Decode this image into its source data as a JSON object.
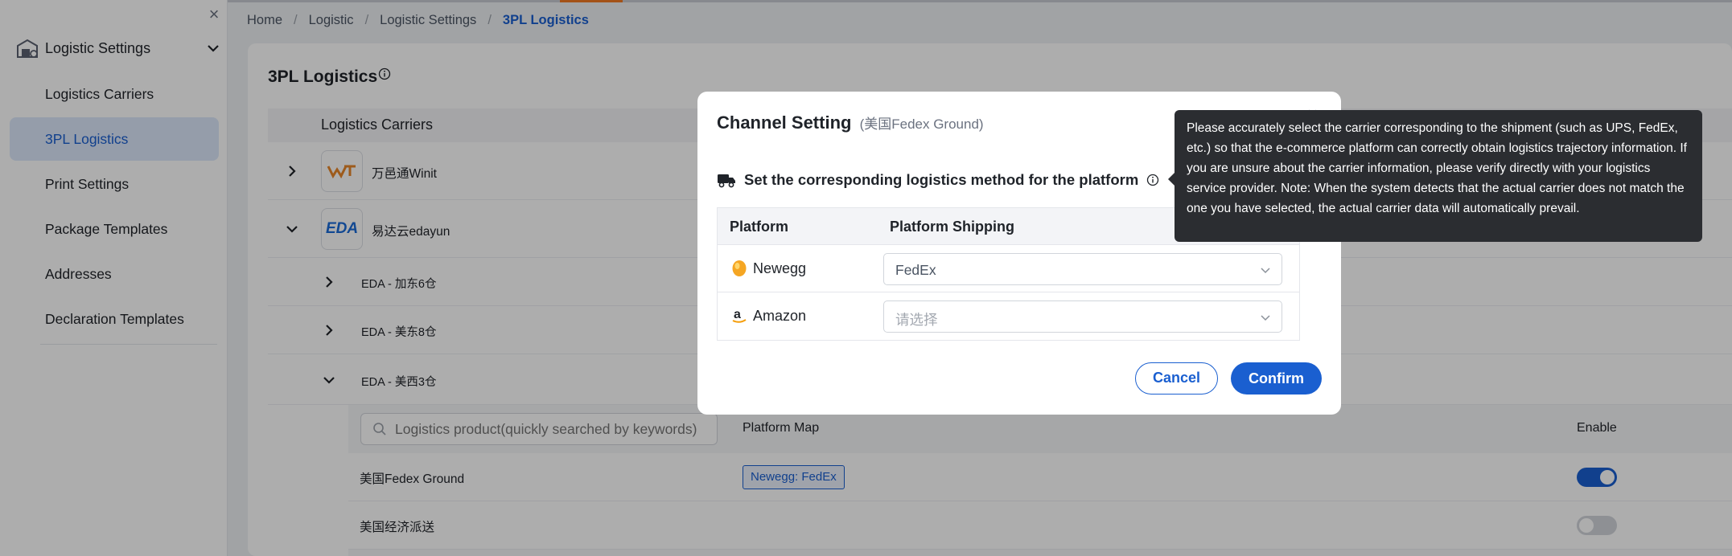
{
  "sidebar": {
    "title": "Logistic Settings",
    "items": [
      {
        "label": "Logistics Carriers"
      },
      {
        "label": "3PL Logistics"
      },
      {
        "label": "Print Settings"
      },
      {
        "label": "Package Templates"
      },
      {
        "label": "Addresses"
      },
      {
        "label": "Declaration Templates"
      }
    ]
  },
  "breadcrumb": [
    "Home",
    "Logistic",
    "Logistic Settings",
    "3PL Logistics"
  ],
  "page": {
    "title": "3PL Logistics",
    "table_header": "Logistics Carriers",
    "carriers": [
      {
        "name": "万邑通Winit",
        "logo": "WT"
      },
      {
        "name": "易达云edayun",
        "logo": "EDA"
      }
    ],
    "warehouses": [
      "EDA - 加东6仓",
      "EDA - 美东8仓",
      "EDA - 美西3仓"
    ],
    "search_placeholder": "Logistics product(quickly searched by keywords)",
    "col_platform_map": "Platform Map",
    "col_enable": "Enable",
    "products": [
      {
        "name": "美国Fedex Ground",
        "map": "Newegg: FedEx",
        "enabled": true
      },
      {
        "name": "美国经济派送",
        "map": "",
        "enabled": false
      }
    ]
  },
  "modal": {
    "title": "Channel Setting",
    "subtitle": "(美国Fedex Ground)",
    "section_title": "Set the corresponding logistics method for the platform",
    "col_platform": "Platform",
    "col_shipping": "Platform Shipping",
    "rows": [
      {
        "platform": "Newegg",
        "value": "FedEx",
        "placeholder": false
      },
      {
        "platform": "Amazon",
        "value": "请选择",
        "placeholder": true
      }
    ],
    "cancel_label": "Cancel",
    "confirm_label": "Confirm"
  },
  "tooltip": {
    "text": "Please accurately select the carrier corresponding to the shipment (such as UPS, FedEx, etc.) so that the e-commerce platform can correctly obtain logistics trajectory information. If you are unsure about the carrier information, please verify directly with your logistics service provider. Note: When the system detects that the actual carrier does not match the one you have selected, the actual carrier data will automatically prevail."
  },
  "colors": {
    "accent": "#1a5fd0",
    "active_bg": "#dce8fb",
    "tooltip_bg": "#2b2d31",
    "top_accent": "#f07a24"
  }
}
